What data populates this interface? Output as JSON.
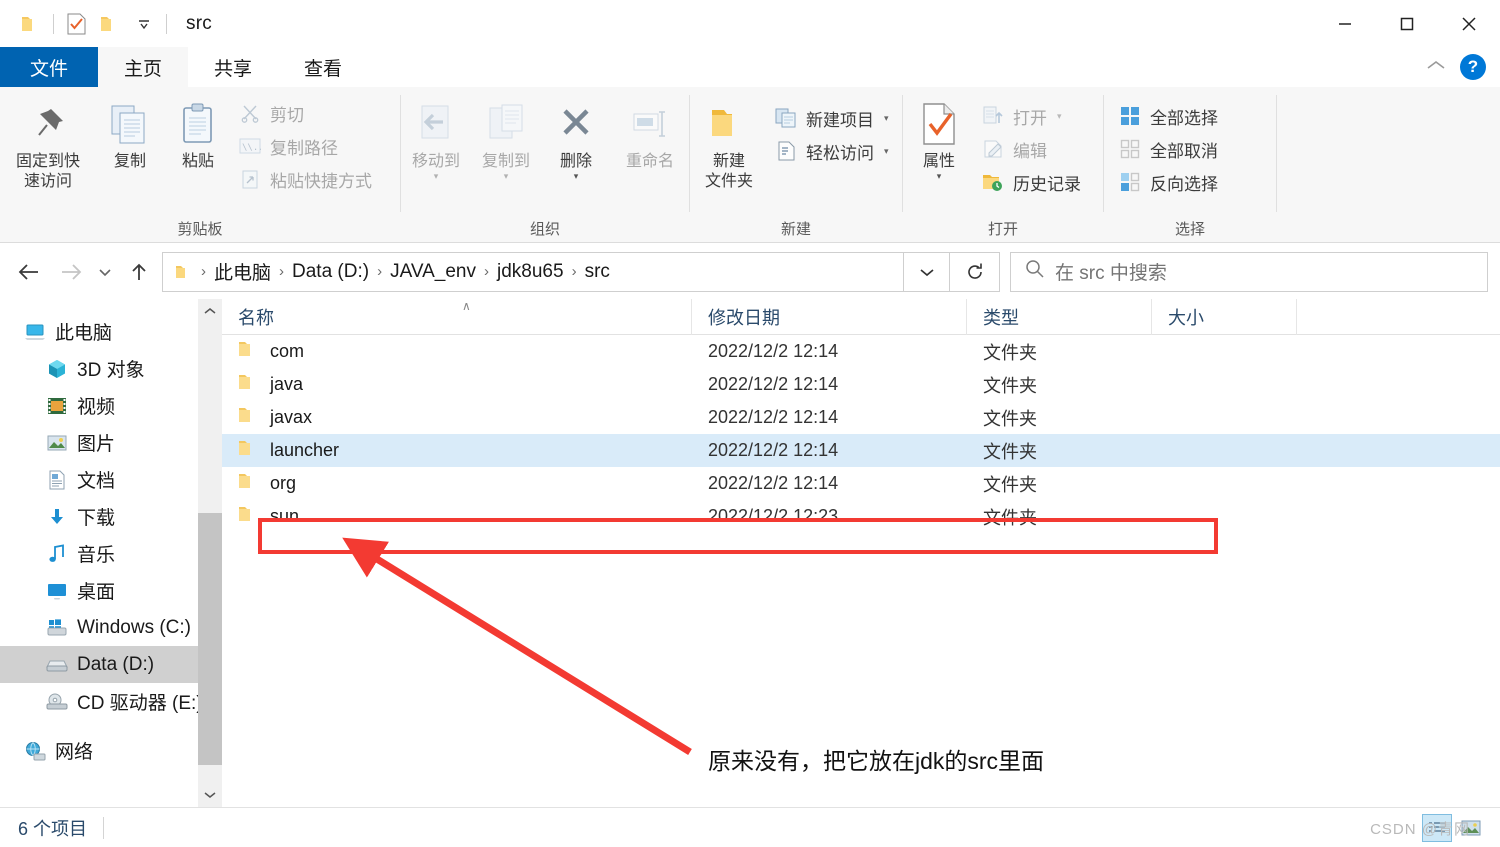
{
  "window": {
    "title": "src",
    "quick_access": [
      "folder-icon",
      "properties-icon",
      "new-folder-icon",
      "customize-dropdown-icon"
    ],
    "controls": {
      "minimize": "—",
      "maximize": "□",
      "close": "✕"
    }
  },
  "tabs": [
    {
      "label": "文件",
      "kind": "file"
    },
    {
      "label": "主页",
      "kind": "active"
    },
    {
      "label": "共享",
      "kind": "normal"
    },
    {
      "label": "查看",
      "kind": "normal"
    }
  ],
  "ribbon": {
    "collapse_icon": "chevron-up-icon",
    "help_label": "?",
    "groups": [
      {
        "name": "clipboard",
        "label": "剪贴板",
        "big": [
          {
            "label_line1": "固定到快",
            "label_line2": "速访问",
            "icon": "pin-icon"
          },
          {
            "label_line1": "复制",
            "label_line2": "",
            "icon": "copy-icon"
          },
          {
            "label_line1": "粘贴",
            "label_line2": "",
            "icon": "paste-icon"
          }
        ],
        "small": [
          {
            "label": "剪切",
            "icon": "scissors-icon",
            "dim": true
          },
          {
            "label": "复制路径",
            "icon": "copy-path-icon",
            "dim": true
          },
          {
            "label": "粘贴快捷方式",
            "icon": "paste-shortcut-icon",
            "dim": true
          }
        ]
      },
      {
        "name": "organize",
        "label": "组织",
        "big": [
          {
            "label_line1": "移动到",
            "label_line2": "",
            "icon": "move-to-icon",
            "caret": true,
            "dim": true
          },
          {
            "label_line1": "复制到",
            "label_line2": "",
            "icon": "copy-to-icon",
            "caret": true,
            "dim": true
          },
          {
            "label_line1": "删除",
            "label_line2": "",
            "icon": "delete-icon",
            "caret": true,
            "dim": true
          },
          {
            "label_line1": "重命名",
            "label_line2": "",
            "icon": "rename-icon",
            "dim": true
          }
        ],
        "small": []
      },
      {
        "name": "new",
        "label": "新建",
        "big": [
          {
            "label_line1": "新建",
            "label_line2": "文件夹",
            "icon": "new-folder-icon"
          }
        ],
        "small": [
          {
            "label": "新建项目",
            "icon": "new-item-icon",
            "caret": true
          },
          {
            "label": "轻松访问",
            "icon": "easy-access-icon",
            "caret": true
          }
        ]
      },
      {
        "name": "open",
        "label": "打开",
        "big": [
          {
            "label_line1": "属性",
            "label_line2": "",
            "icon": "properties-icon",
            "caret": true
          }
        ],
        "small": [
          {
            "label": "打开",
            "icon": "open-icon",
            "caret": true,
            "dim": true
          },
          {
            "label": "编辑",
            "icon": "edit-icon",
            "dim": true
          },
          {
            "label": "历史记录",
            "icon": "history-icon"
          }
        ]
      },
      {
        "name": "select",
        "label": "选择",
        "big": [],
        "small": [
          {
            "label": "全部选择",
            "icon": "select-all-icon"
          },
          {
            "label": "全部取消",
            "icon": "select-none-icon"
          },
          {
            "label": "反向选择",
            "icon": "invert-selection-icon"
          }
        ]
      }
    ]
  },
  "address": {
    "back_icon": "back-arrow-icon",
    "forward_icon": "forward-arrow-icon",
    "recent_icon": "chevron-down-icon",
    "up_icon": "up-arrow-icon",
    "crumbs": [
      "此电脑",
      "Data (D:)",
      "JAVA_env",
      "jdk8u65",
      "src"
    ],
    "separator": "›",
    "dropdown_icon": "chevron-down-icon",
    "refresh_icon": "refresh-icon",
    "search_placeholder": "在 src 中搜索",
    "search_value": ""
  },
  "navpane": {
    "items": [
      {
        "label": "此电脑",
        "icon": "computer-icon",
        "level": 1,
        "selected": false
      },
      {
        "label": "3D 对象",
        "icon": "3d-objects-icon",
        "level": 2,
        "selected": false
      },
      {
        "label": "视频",
        "icon": "videos-icon",
        "level": 2,
        "selected": false
      },
      {
        "label": "图片",
        "icon": "pictures-icon",
        "level": 2,
        "selected": false
      },
      {
        "label": "文档",
        "icon": "documents-icon",
        "level": 2,
        "selected": false
      },
      {
        "label": "下载",
        "icon": "downloads-icon",
        "level": 2,
        "selected": false
      },
      {
        "label": "音乐",
        "icon": "music-icon",
        "level": 2,
        "selected": false
      },
      {
        "label": "桌面",
        "icon": "desktop-icon",
        "level": 2,
        "selected": false
      },
      {
        "label": "Windows (C:)",
        "icon": "windows-drive-icon",
        "level": 2,
        "selected": false
      },
      {
        "label": "Data (D:)",
        "icon": "hard-drive-icon",
        "level": 2,
        "selected": true
      },
      {
        "label": "CD 驱动器 (E:)",
        "icon": "cd-drive-icon",
        "level": 2,
        "selected": false
      },
      {
        "label": "网络",
        "icon": "network-icon",
        "level": 1,
        "selected": false,
        "spacer_before": true
      }
    ]
  },
  "filelist": {
    "columns": [
      "名称",
      "修改日期",
      "类型",
      "大小"
    ],
    "sort_indicator": "∧",
    "rows": [
      {
        "name": "com",
        "date": "2022/12/2 12:14",
        "type": "文件夹",
        "size": "",
        "selected": false,
        "boxed": false
      },
      {
        "name": "java",
        "date": "2022/12/2 12:14",
        "type": "文件夹",
        "size": "",
        "selected": false,
        "boxed": false
      },
      {
        "name": "javax",
        "date": "2022/12/2 12:14",
        "type": "文件夹",
        "size": "",
        "selected": false,
        "boxed": false
      },
      {
        "name": "launcher",
        "date": "2022/12/2 12:14",
        "type": "文件夹",
        "size": "",
        "selected": true,
        "boxed": false
      },
      {
        "name": "org",
        "date": "2022/12/2 12:14",
        "type": "文件夹",
        "size": "",
        "selected": false,
        "boxed": false
      },
      {
        "name": "sun",
        "date": "2022/12/2 12:23",
        "type": "文件夹",
        "size": "",
        "selected": false,
        "boxed": true
      }
    ]
  },
  "annotation": {
    "text": "原来没有，把它放在jdk的src里面",
    "color": "#f33a32"
  },
  "statusbar": {
    "item_count": "6 个项目",
    "view_details_icon": "details-view-icon",
    "view_large_icon": "large-icons-view-icon"
  },
  "watermark": {
    "text": "CSDN @青网"
  },
  "colors": {
    "accent": "#0063b1",
    "selection": "#d9ebf9",
    "annotation": "#f33a32",
    "folder": "#f7d07a",
    "header_text": "#2a4a6b"
  }
}
